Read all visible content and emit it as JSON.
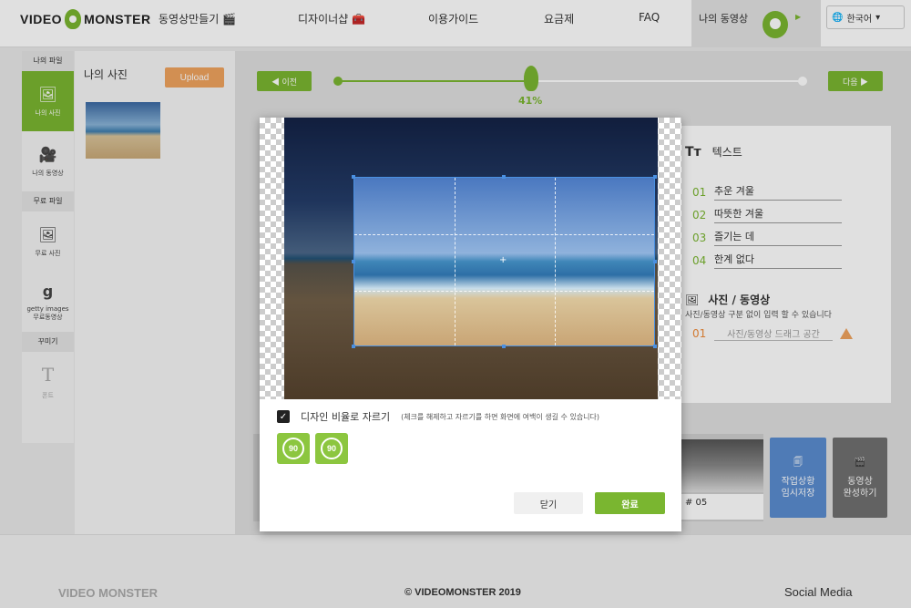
{
  "header": {
    "logo_left": "VIDEO",
    "logo_right": "MONSTER",
    "nav": [
      {
        "label": "동영상만들기 🎬"
      },
      {
        "label": "디자이너샵 🧰"
      },
      {
        "label": "이용가이드"
      },
      {
        "label": "요금제"
      },
      {
        "label": "FAQ"
      }
    ],
    "my_videos": "나의 동영상",
    "language": "한국어"
  },
  "sidebar": {
    "my_files": "나의 파일",
    "my_photo": "나의 사진",
    "my_video": "나의 동영상",
    "free_files": "무료 파일",
    "free_photo": "무료 사진",
    "getty_line1": "getty images",
    "getty_line2": "무료동영상",
    "decorate": "꾸미기",
    "font": "폰트"
  },
  "photos_panel": {
    "title": "나의 사진",
    "upload": "Upload"
  },
  "stepper": {
    "prev": "◀ 이전",
    "next": "다음 ▶",
    "progress_label": "41%",
    "progress": 0.41
  },
  "text_panel": {
    "title_icon": "Tт",
    "title": "텍스트",
    "rows": [
      {
        "num": "01",
        "text": "추운 겨울"
      },
      {
        "num": "02",
        "text": "따뜻한 겨울"
      },
      {
        "num": "03",
        "text": "즐기는 데"
      },
      {
        "num": "04",
        "text": "한계 없다"
      }
    ],
    "media_title": "사진 / 동영상",
    "media_sub": "사진/동영상 구분 없이 입력 할 수 있습니다",
    "media_num": "01",
    "media_placeholder": "사진/동영상 드래그 공간"
  },
  "timeline": {
    "scene_label": "# 05",
    "save_line1": "작업상황",
    "save_line2": "임시저장",
    "finish_line1": "동영상",
    "finish_line2": "완성하기"
  },
  "modal": {
    "ratio_label": "디자인 비율로 자르기",
    "ratio_note": "(체크를 해제하고 자르기를 하면 화면에 여백이 생길 수 있습니다)",
    "rotate_left": "90",
    "rotate_right": "90",
    "close": "닫기",
    "done": "완료"
  },
  "footer": {
    "logo": "VIDEO MONSTER",
    "copyright": "© VIDEOMONSTER 2019",
    "social": "Social Media"
  },
  "colors": {
    "accent": "#7ab630",
    "upload": "#f0a35e",
    "save": "#5a8cd0",
    "finish": "#707070"
  }
}
